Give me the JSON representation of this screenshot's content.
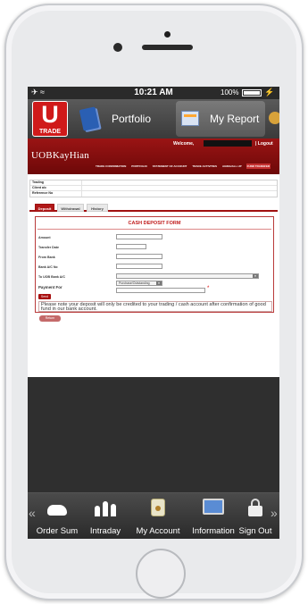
{
  "status_bar": {
    "left": "✈ ≈",
    "time": "10:21 AM",
    "battery_text": "100%",
    "battery_level": 1.0,
    "charging_glyph": "⚡"
  },
  "top_nav": {
    "logo_letter": "U",
    "logo_text": "TRADE",
    "tabs": [
      {
        "label": "Portfolio",
        "icon": "notebook-icon"
      },
      {
        "label": "My Report",
        "icon": "report-icon"
      }
    ]
  },
  "web": {
    "logo": "UOBKayHian",
    "welcome": "Welcome,",
    "logout": "| Logout",
    "menu": [
      "TRADE CONFIRMATION",
      "PORTFOLIO",
      "STATEMENT OF ACCOUNT",
      "TRADE ACTIVITIES",
      "AGING/ALL-UP",
      "FUND TRANSFER"
    ],
    "info_rows": [
      {
        "label": "Trading",
        "value": ""
      },
      {
        "label": "Client a/c",
        "value": ""
      },
      {
        "label": "Reference No",
        "value": ""
      }
    ],
    "tabs": [
      "Deposit",
      "Withdrawal",
      "History"
    ],
    "form": {
      "title": "CASH DEPOSIT FORM",
      "fields": [
        "Amount",
        "Transfer Date",
        "From Bank",
        "Bank A/C No",
        "To UOB Bank A/C",
        "Payment For"
      ],
      "payment_for_value": "Purchase/Outstanding",
      "submit": "Send",
      "note": "Please note your deposit will only be credited to your trading / cash account after confirmation of good fund in our bank account.",
      "back": "Return"
    }
  },
  "bottom_bar": {
    "items": [
      {
        "label": "Order Sum",
        "icon": "bull-icon"
      },
      {
        "label": "Intraday",
        "icon": "intraday-chart-icon"
      },
      {
        "label": "My Account",
        "icon": "account-icon"
      },
      {
        "label": "Information",
        "icon": "information-icon"
      },
      {
        "label": "Sign Out",
        "icon": "lock-icon"
      }
    ],
    "left_chevron": "«",
    "right_chevron": "»"
  }
}
